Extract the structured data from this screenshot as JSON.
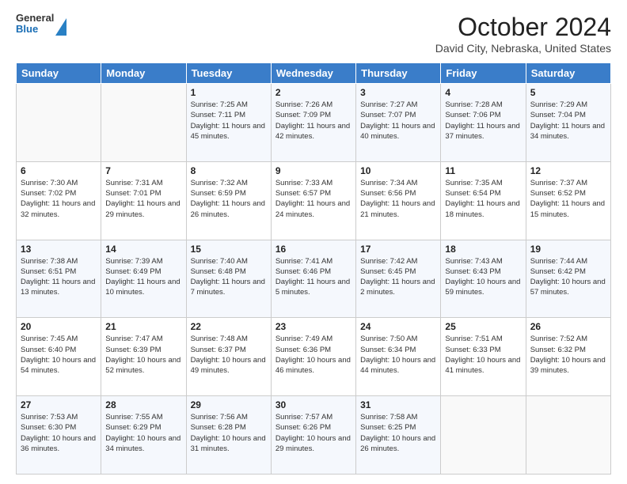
{
  "logo": {
    "general": "General",
    "blue": "Blue"
  },
  "title": "October 2024",
  "subtitle": "David City, Nebraska, United States",
  "days_of_week": [
    "Sunday",
    "Monday",
    "Tuesday",
    "Wednesday",
    "Thursday",
    "Friday",
    "Saturday"
  ],
  "weeks": [
    [
      {
        "day": "",
        "sunrise": "",
        "sunset": "",
        "daylight": ""
      },
      {
        "day": "",
        "sunrise": "",
        "sunset": "",
        "daylight": ""
      },
      {
        "day": "1",
        "sunrise": "Sunrise: 7:25 AM",
        "sunset": "Sunset: 7:11 PM",
        "daylight": "Daylight: 11 hours and 45 minutes."
      },
      {
        "day": "2",
        "sunrise": "Sunrise: 7:26 AM",
        "sunset": "Sunset: 7:09 PM",
        "daylight": "Daylight: 11 hours and 42 minutes."
      },
      {
        "day": "3",
        "sunrise": "Sunrise: 7:27 AM",
        "sunset": "Sunset: 7:07 PM",
        "daylight": "Daylight: 11 hours and 40 minutes."
      },
      {
        "day": "4",
        "sunrise": "Sunrise: 7:28 AM",
        "sunset": "Sunset: 7:06 PM",
        "daylight": "Daylight: 11 hours and 37 minutes."
      },
      {
        "day": "5",
        "sunrise": "Sunrise: 7:29 AM",
        "sunset": "Sunset: 7:04 PM",
        "daylight": "Daylight: 11 hours and 34 minutes."
      }
    ],
    [
      {
        "day": "6",
        "sunrise": "Sunrise: 7:30 AM",
        "sunset": "Sunset: 7:02 PM",
        "daylight": "Daylight: 11 hours and 32 minutes."
      },
      {
        "day": "7",
        "sunrise": "Sunrise: 7:31 AM",
        "sunset": "Sunset: 7:01 PM",
        "daylight": "Daylight: 11 hours and 29 minutes."
      },
      {
        "day": "8",
        "sunrise": "Sunrise: 7:32 AM",
        "sunset": "Sunset: 6:59 PM",
        "daylight": "Daylight: 11 hours and 26 minutes."
      },
      {
        "day": "9",
        "sunrise": "Sunrise: 7:33 AM",
        "sunset": "Sunset: 6:57 PM",
        "daylight": "Daylight: 11 hours and 24 minutes."
      },
      {
        "day": "10",
        "sunrise": "Sunrise: 7:34 AM",
        "sunset": "Sunset: 6:56 PM",
        "daylight": "Daylight: 11 hours and 21 minutes."
      },
      {
        "day": "11",
        "sunrise": "Sunrise: 7:35 AM",
        "sunset": "Sunset: 6:54 PM",
        "daylight": "Daylight: 11 hours and 18 minutes."
      },
      {
        "day": "12",
        "sunrise": "Sunrise: 7:37 AM",
        "sunset": "Sunset: 6:52 PM",
        "daylight": "Daylight: 11 hours and 15 minutes."
      }
    ],
    [
      {
        "day": "13",
        "sunrise": "Sunrise: 7:38 AM",
        "sunset": "Sunset: 6:51 PM",
        "daylight": "Daylight: 11 hours and 13 minutes."
      },
      {
        "day": "14",
        "sunrise": "Sunrise: 7:39 AM",
        "sunset": "Sunset: 6:49 PM",
        "daylight": "Daylight: 11 hours and 10 minutes."
      },
      {
        "day": "15",
        "sunrise": "Sunrise: 7:40 AM",
        "sunset": "Sunset: 6:48 PM",
        "daylight": "Daylight: 11 hours and 7 minutes."
      },
      {
        "day": "16",
        "sunrise": "Sunrise: 7:41 AM",
        "sunset": "Sunset: 6:46 PM",
        "daylight": "Daylight: 11 hours and 5 minutes."
      },
      {
        "day": "17",
        "sunrise": "Sunrise: 7:42 AM",
        "sunset": "Sunset: 6:45 PM",
        "daylight": "Daylight: 11 hours and 2 minutes."
      },
      {
        "day": "18",
        "sunrise": "Sunrise: 7:43 AM",
        "sunset": "Sunset: 6:43 PM",
        "daylight": "Daylight: 10 hours and 59 minutes."
      },
      {
        "day": "19",
        "sunrise": "Sunrise: 7:44 AM",
        "sunset": "Sunset: 6:42 PM",
        "daylight": "Daylight: 10 hours and 57 minutes."
      }
    ],
    [
      {
        "day": "20",
        "sunrise": "Sunrise: 7:45 AM",
        "sunset": "Sunset: 6:40 PM",
        "daylight": "Daylight: 10 hours and 54 minutes."
      },
      {
        "day": "21",
        "sunrise": "Sunrise: 7:47 AM",
        "sunset": "Sunset: 6:39 PM",
        "daylight": "Daylight: 10 hours and 52 minutes."
      },
      {
        "day": "22",
        "sunrise": "Sunrise: 7:48 AM",
        "sunset": "Sunset: 6:37 PM",
        "daylight": "Daylight: 10 hours and 49 minutes."
      },
      {
        "day": "23",
        "sunrise": "Sunrise: 7:49 AM",
        "sunset": "Sunset: 6:36 PM",
        "daylight": "Daylight: 10 hours and 46 minutes."
      },
      {
        "day": "24",
        "sunrise": "Sunrise: 7:50 AM",
        "sunset": "Sunset: 6:34 PM",
        "daylight": "Daylight: 10 hours and 44 minutes."
      },
      {
        "day": "25",
        "sunrise": "Sunrise: 7:51 AM",
        "sunset": "Sunset: 6:33 PM",
        "daylight": "Daylight: 10 hours and 41 minutes."
      },
      {
        "day": "26",
        "sunrise": "Sunrise: 7:52 AM",
        "sunset": "Sunset: 6:32 PM",
        "daylight": "Daylight: 10 hours and 39 minutes."
      }
    ],
    [
      {
        "day": "27",
        "sunrise": "Sunrise: 7:53 AM",
        "sunset": "Sunset: 6:30 PM",
        "daylight": "Daylight: 10 hours and 36 minutes."
      },
      {
        "day": "28",
        "sunrise": "Sunrise: 7:55 AM",
        "sunset": "Sunset: 6:29 PM",
        "daylight": "Daylight: 10 hours and 34 minutes."
      },
      {
        "day": "29",
        "sunrise": "Sunrise: 7:56 AM",
        "sunset": "Sunset: 6:28 PM",
        "daylight": "Daylight: 10 hours and 31 minutes."
      },
      {
        "day": "30",
        "sunrise": "Sunrise: 7:57 AM",
        "sunset": "Sunset: 6:26 PM",
        "daylight": "Daylight: 10 hours and 29 minutes."
      },
      {
        "day": "31",
        "sunrise": "Sunrise: 7:58 AM",
        "sunset": "Sunset: 6:25 PM",
        "daylight": "Daylight: 10 hours and 26 minutes."
      },
      {
        "day": "",
        "sunrise": "",
        "sunset": "",
        "daylight": ""
      },
      {
        "day": "",
        "sunrise": "",
        "sunset": "",
        "daylight": ""
      }
    ]
  ]
}
